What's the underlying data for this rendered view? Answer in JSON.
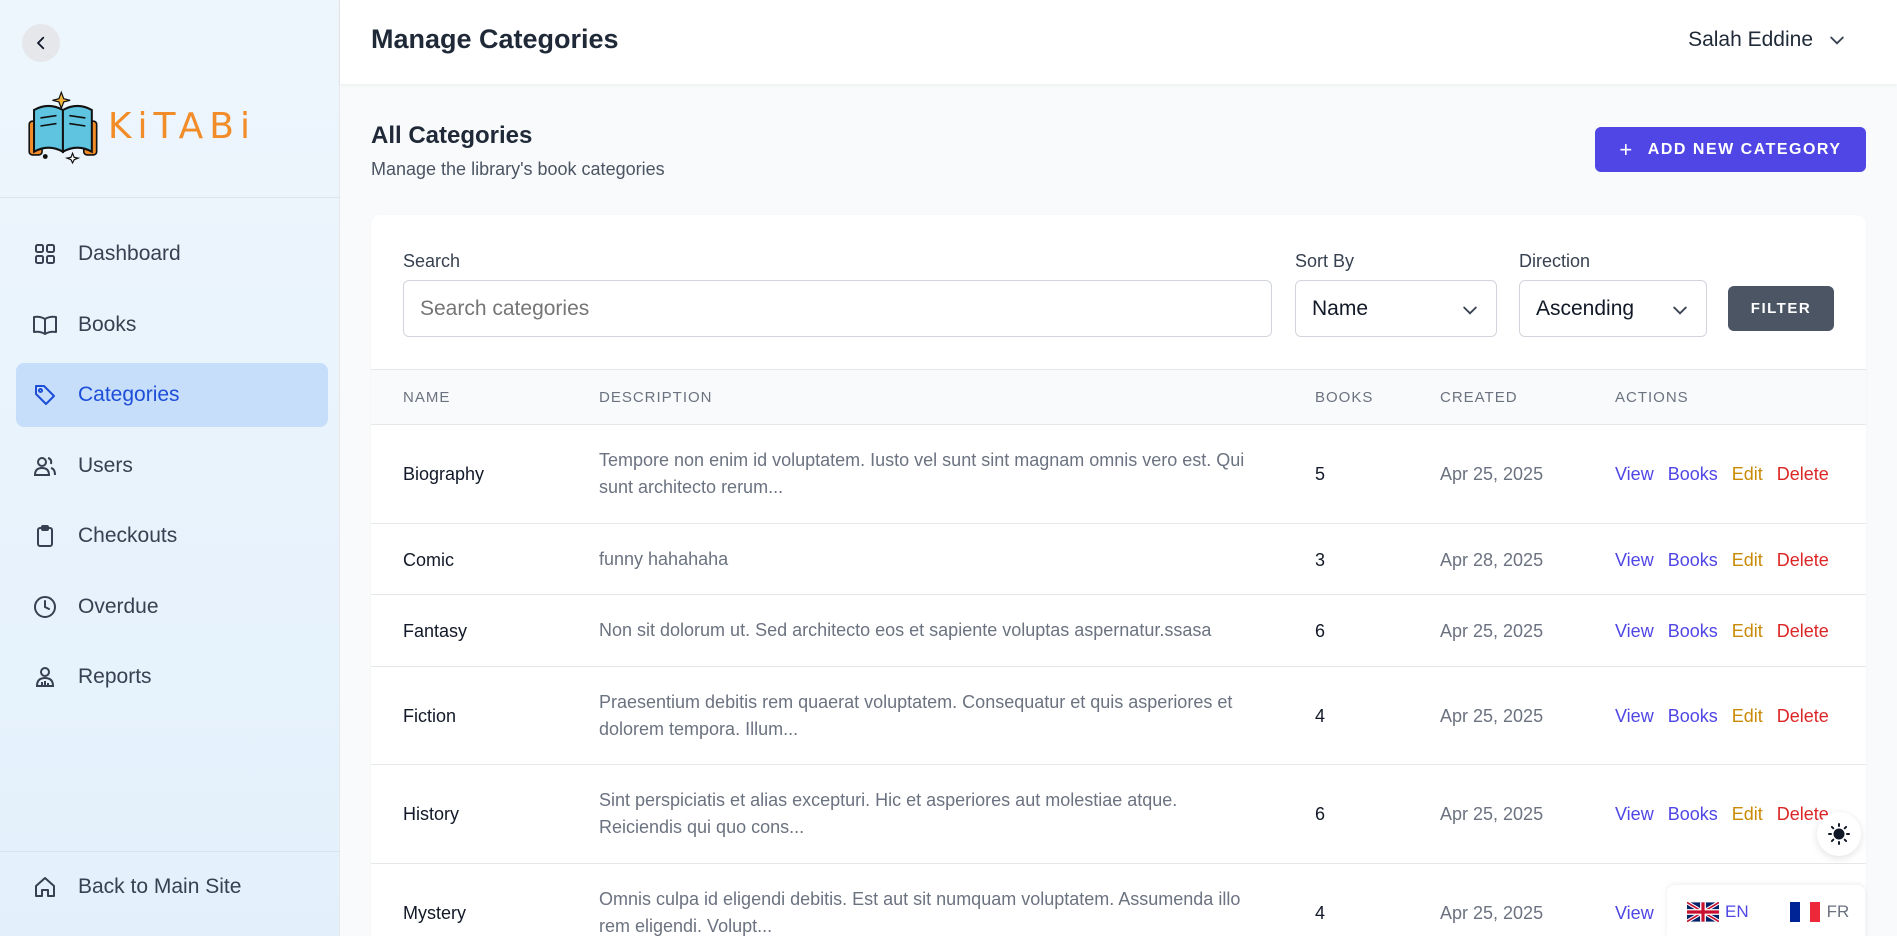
{
  "sidebar": {
    "brand": "KiTABi",
    "nav": [
      {
        "label": "Dashboard",
        "icon": "grid-icon"
      },
      {
        "label": "Books",
        "icon": "book-open-icon"
      },
      {
        "label": "Categories",
        "icon": "tag-icon",
        "active": true
      },
      {
        "label": "Users",
        "icon": "users-icon"
      },
      {
        "label": "Checkouts",
        "icon": "clipboard-icon"
      },
      {
        "label": "Overdue",
        "icon": "clock-icon"
      },
      {
        "label": "Reports",
        "icon": "user-chart-icon"
      }
    ],
    "back_label": "Back to Main Site"
  },
  "header": {
    "title": "Manage Categories",
    "user_name": "Salah Eddine"
  },
  "section": {
    "title": "All Categories",
    "subtitle": "Manage the library's book categories",
    "add_button": "ADD NEW CATEGORY"
  },
  "filters": {
    "search_label": "Search",
    "search_placeholder": "Search categories",
    "sort_label": "Sort By",
    "sort_value": "Name",
    "direction_label": "Direction",
    "direction_value": "Ascending",
    "filter_button": "FILTER"
  },
  "table": {
    "columns": [
      "NAME",
      "DESCRIPTION",
      "BOOKS",
      "CREATED",
      "ACTIONS"
    ],
    "actions": {
      "view": "View",
      "books": "Books",
      "edit": "Edit",
      "delete": "Delete"
    },
    "rows": [
      {
        "name": "Biography",
        "description": "Tempore non enim id voluptatem. Iusto vel sunt sint magnam omnis vero est. Qui sunt architecto rerum...",
        "books": "5",
        "created": "Apr 25, 2025"
      },
      {
        "name": "Comic",
        "description": "funny hahahaha",
        "books": "3",
        "created": "Apr 28, 2025"
      },
      {
        "name": "Fantasy",
        "description": "Non sit dolorum ut. Sed architecto eos et sapiente voluptas aspernatur.ssasa",
        "books": "6",
        "created": "Apr 25, 2025"
      },
      {
        "name": "Fiction",
        "description": "Praesentium debitis rem quaerat voluptatem. Consequatur et quis asperiores et dolorem tempora. Illum...",
        "books": "4",
        "created": "Apr 25, 2025"
      },
      {
        "name": "History",
        "description": "Sint perspiciatis et alias excepturi. Hic et asperiores aut molestiae atque. Reiciendis qui quo cons...",
        "books": "6",
        "created": "Apr 25, 2025"
      },
      {
        "name": "Mystery",
        "description": "Omnis culpa id eligendi debitis. Est aut sit numquam voluptatem. Assumenda illo rem eligendi. Volupt...",
        "books": "4",
        "created": "Apr 25, 2025"
      }
    ]
  },
  "languages": [
    {
      "code": "EN",
      "flag": "uk-flag-icon",
      "active": true
    },
    {
      "code": "FR",
      "flag": "france-flag-icon",
      "active": false
    }
  ],
  "colors": {
    "accent": "#4f46e5",
    "edit": "#ca8a04",
    "delete": "#dc2626",
    "brand": "#f28c28",
    "active_nav_bg": "#c7defa"
  }
}
